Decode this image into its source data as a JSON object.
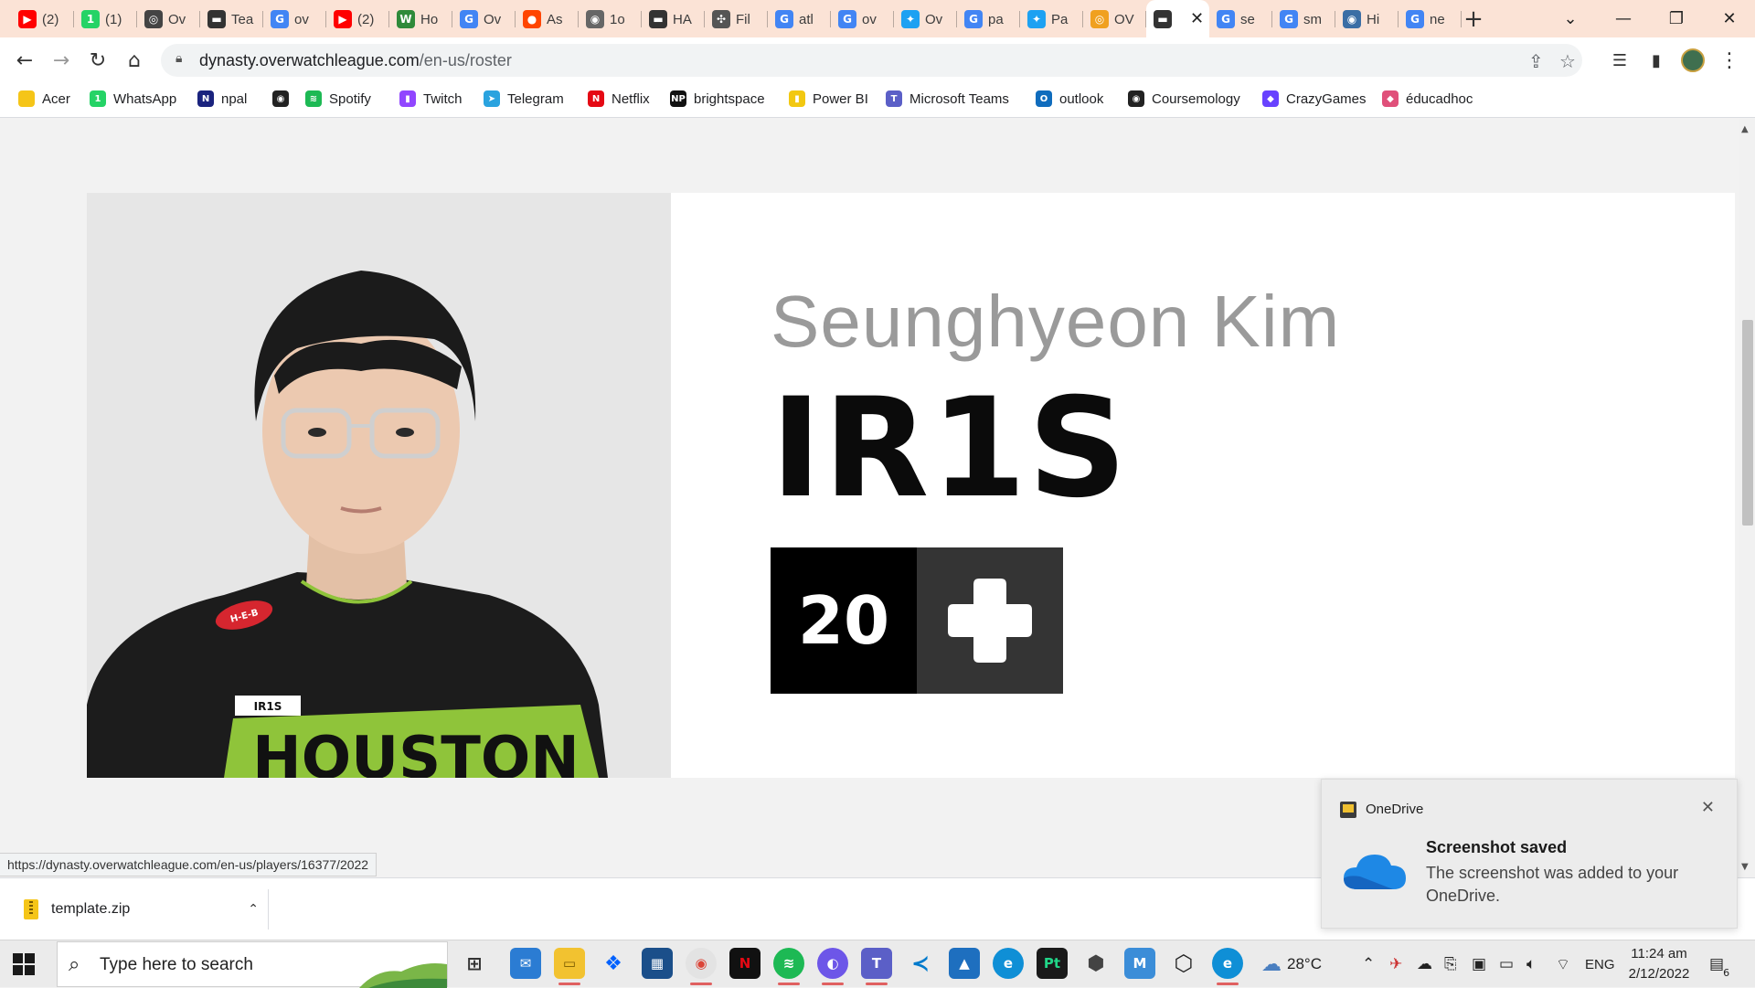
{
  "browser": {
    "tabs": [
      {
        "label": "(2)",
        "icon": "youtube-icon",
        "color": "#ff0000",
        "glyph": "▶"
      },
      {
        "label": "(1)",
        "icon": "whatsapp-icon",
        "color": "#25d366",
        "glyph": "1"
      },
      {
        "label": "Ov",
        "icon": "overwatch-icon",
        "color": "#444444",
        "glyph": "◎"
      },
      {
        "label": "Tea",
        "icon": "flag-icon",
        "color": "#333333",
        "glyph": "▬"
      },
      {
        "label": "ov",
        "icon": "google-icon",
        "color": "#4285f4",
        "glyph": "G"
      },
      {
        "label": "(2)",
        "icon": "youtube-icon",
        "color": "#ff0000",
        "glyph": "▶"
      },
      {
        "label": "Ho",
        "icon": "wikihow-icon",
        "color": "#2f8a3a",
        "glyph": "W"
      },
      {
        "label": "Ov",
        "icon": "google-icon",
        "color": "#4285f4",
        "glyph": "G"
      },
      {
        "label": "As",
        "icon": "reddit-icon",
        "color": "#ff4500",
        "glyph": "●"
      },
      {
        "label": "1o",
        "icon": "globe-icon",
        "color": "#666666",
        "glyph": "◉"
      },
      {
        "label": "HA",
        "icon": "flag-icon",
        "color": "#333333",
        "glyph": "▬"
      },
      {
        "label": "Fil",
        "icon": "puzzle-icon",
        "color": "#555555",
        "glyph": "✣"
      },
      {
        "label": "atl",
        "icon": "google-icon",
        "color": "#4285f4",
        "glyph": "G"
      },
      {
        "label": "ov",
        "icon": "google-icon",
        "color": "#4285f4",
        "glyph": "G"
      },
      {
        "label": "Ov",
        "icon": "twitter-icon",
        "color": "#1da1f2",
        "glyph": "✦"
      },
      {
        "label": "pa",
        "icon": "google-icon",
        "color": "#4285f4",
        "glyph": "G"
      },
      {
        "label": "Pa",
        "icon": "twitter-icon",
        "color": "#1da1f2",
        "glyph": "✦"
      },
      {
        "label": "OV",
        "icon": "ow-orange-icon",
        "color": "#f0a020",
        "glyph": "◎"
      },
      {
        "label": "",
        "icon": "flag-icon",
        "color": "#333333",
        "glyph": "▬",
        "active": true
      },
      {
        "label": "se",
        "icon": "google-icon",
        "color": "#4285f4",
        "glyph": "G"
      },
      {
        "label": "sm",
        "icon": "google-icon",
        "color": "#4285f4",
        "glyph": "G"
      },
      {
        "label": "Hi",
        "icon": "globe-icon",
        "color": "#3b6ea5",
        "glyph": "◉"
      },
      {
        "label": "ne",
        "icon": "google-icon",
        "color": "#4285f4",
        "glyph": "G"
      }
    ],
    "url_host": "dynasty.overwatchleague.com",
    "url_path": "/en-us/roster",
    "bookmarks": [
      {
        "label": "Acer",
        "icon": "folder-icon",
        "color": "#f5c518",
        "glyph": ""
      },
      {
        "label": "WhatsApp",
        "icon": "whatsapp-icon",
        "color": "#25d366",
        "glyph": "1"
      },
      {
        "label": "npal",
        "icon": "npal-icon",
        "color": "#1a237e",
        "glyph": "N"
      },
      {
        "label": "",
        "icon": "globe-icon",
        "color": "#222222",
        "glyph": "◉"
      },
      {
        "label": "Spotify",
        "icon": "spotify-icon",
        "color": "#1db954",
        "glyph": "≋"
      },
      {
        "label": "Twitch",
        "icon": "twitch-icon",
        "color": "#9146ff",
        "glyph": "▮"
      },
      {
        "label": "Telegram",
        "icon": "telegram-icon",
        "color": "#2aa3df",
        "glyph": "➤"
      },
      {
        "label": "Netflix",
        "icon": "netflix-icon",
        "color": "#e50914",
        "glyph": "N"
      },
      {
        "label": "brightspace",
        "icon": "np-icon",
        "color": "#111111",
        "glyph": "NP"
      },
      {
        "label": "Power BI",
        "icon": "powerbi-icon",
        "color": "#f2c811",
        "glyph": "▮"
      },
      {
        "label": "Microsoft Teams",
        "icon": "teams-icon",
        "color": "#5b5fc7",
        "glyph": "T"
      },
      {
        "label": "outlook",
        "icon": "outlook-icon",
        "color": "#0f6cbd",
        "glyph": "O"
      },
      {
        "label": "Coursemology",
        "icon": "coursemology-icon",
        "color": "#222222",
        "glyph": "◉"
      },
      {
        "label": "CrazyGames",
        "icon": "crazygames-icon",
        "color": "#6842ff",
        "glyph": "◆"
      },
      {
        "label": "éducadhoc",
        "icon": "educadhoc-icon",
        "color": "#e0507a",
        "glyph": "◆"
      }
    ]
  },
  "player": {
    "real_name": "Seunghyeon Kim",
    "handle": "IR1S",
    "number": "20",
    "role_icon": "support-cross-icon",
    "jersey_name": "IR1S",
    "jersey_text": "HOUSTON",
    "sponsor": "H-E-B"
  },
  "status_url": "https://dynasty.overwatchleague.com/en-us/players/16377/2022",
  "download": {
    "filename": "template.zip"
  },
  "toast": {
    "app": "OneDrive",
    "title": "Screenshot saved",
    "body": "The screenshot was added to your OneDrive."
  },
  "taskbar": {
    "search_placeholder": "Type here to search",
    "weather": "28°C",
    "language": "ENG",
    "time": "11:24 am",
    "date": "2/12/2022",
    "notification_count": "6"
  }
}
